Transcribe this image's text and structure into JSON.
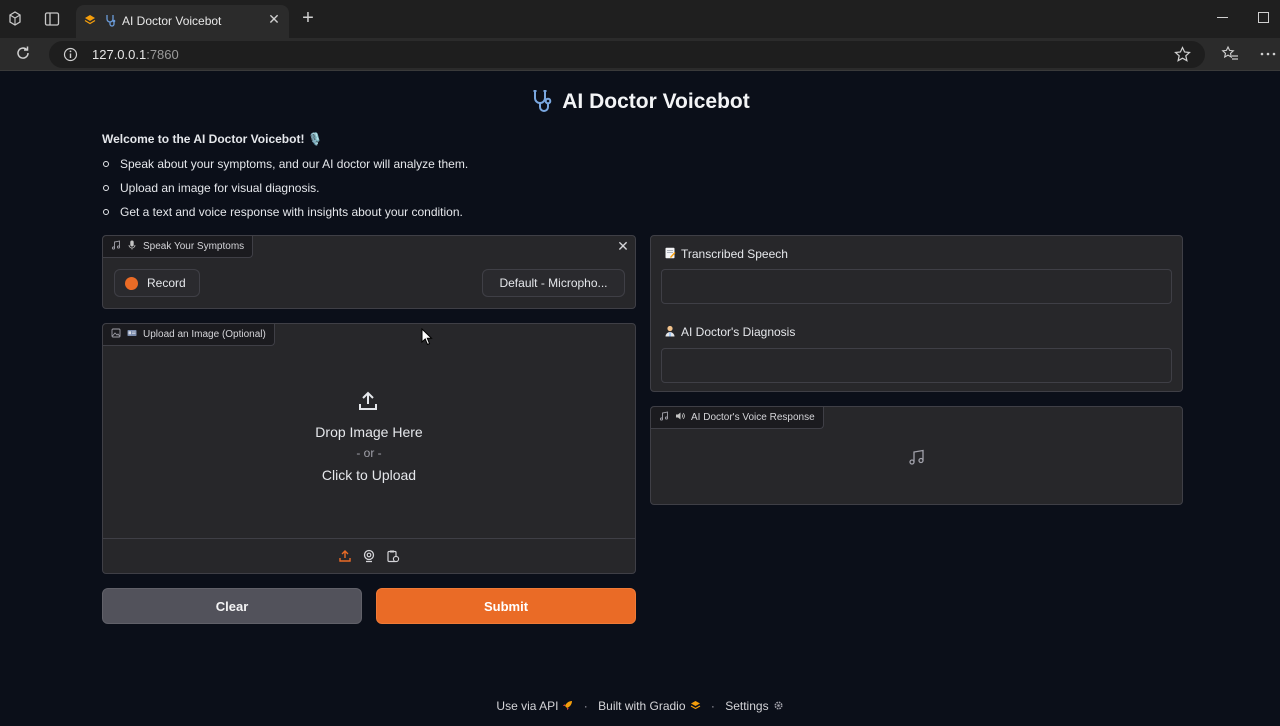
{
  "browser": {
    "tab_title": "AI Doctor Voicebot",
    "tab_close": "✕",
    "new_tab": "+",
    "url_host": "127.0.0.1",
    "url_port": ":7860"
  },
  "page": {
    "title": "AI Doctor Voicebot",
    "intro_heading": "Welcome to the AI Doctor Voicebot! 🎙️",
    "intro_items": [
      "Speak about your symptoms, and our AI doctor will analyze them.",
      "Upload an image for visual diagnosis.",
      "Get a text and voice response with insights about your condition."
    ]
  },
  "audio_input": {
    "label": "Speak Your Symptoms",
    "record_label": "Record",
    "mic_select": "Default - Micropho..."
  },
  "image_input": {
    "label": "Upload an Image (Optional)",
    "drop_line1": "Drop Image Here",
    "drop_line2": "- or -",
    "drop_line3": "Click to Upload"
  },
  "buttons": {
    "clear": "Clear",
    "submit": "Submit"
  },
  "outputs": {
    "transcribed_label": "Transcribed Speech",
    "transcribed_value": "",
    "diagnosis_label": "AI Doctor's Diagnosis",
    "diagnosis_value": "",
    "voice_label": "AI Doctor's Voice Response"
  },
  "footer": {
    "api": "Use via API",
    "built": "Built with Gradio",
    "settings": "Settings",
    "sep": "·"
  },
  "colors": {
    "accent": "#ea6b26",
    "background": "#0b0f19",
    "panel": "#27272a"
  }
}
